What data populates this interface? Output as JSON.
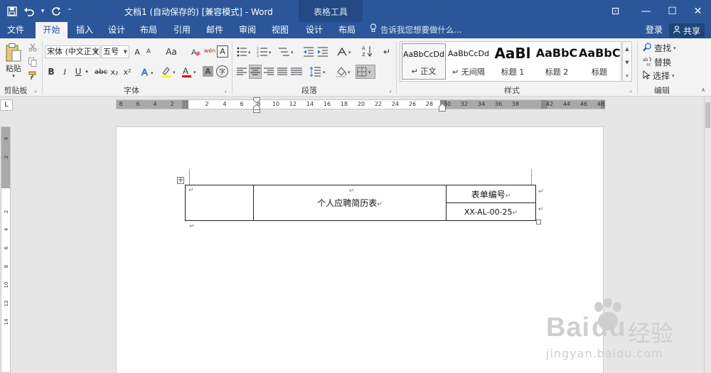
{
  "window": {
    "title": "文档1 (自动保存的) [兼容模式] - Word",
    "context_tab_label": "表格工具",
    "controls": {
      "ribbon_options": "⊡",
      "minimize": "—",
      "maximize": "☐",
      "close": "✕"
    }
  },
  "qat": {
    "save_icon": "save-icon",
    "undo_icon": "undo-icon",
    "redo_icon": "redo-icon"
  },
  "tabs": [
    {
      "label": "文件",
      "active": false
    },
    {
      "label": "开始",
      "active": true
    },
    {
      "label": "插入",
      "active": false
    },
    {
      "label": "设计",
      "active": false
    },
    {
      "label": "布局",
      "active": false
    },
    {
      "label": "引用",
      "active": false
    },
    {
      "label": "邮件",
      "active": false
    },
    {
      "label": "审阅",
      "active": false
    },
    {
      "label": "视图",
      "active": false
    },
    {
      "label": "设计",
      "active": false
    },
    {
      "label": "布局",
      "active": false
    }
  ],
  "tellme": {
    "placeholder": "告诉我您想要做什么..."
  },
  "account": {
    "login": "登录",
    "share": "共享"
  },
  "ribbon": {
    "clipboard": {
      "paste_label": "粘贴",
      "group_label": "剪贴板"
    },
    "font": {
      "font_name": "宋体 (中文正文",
      "font_size": "五号",
      "group_label": "字体",
      "bold": "B",
      "italic": "I",
      "underline": "U",
      "strike": "abc",
      "subscript": "x₂",
      "superscript": "x²",
      "grow": "A",
      "shrink": "A",
      "case": "Aa",
      "phonetic": "wén",
      "clear": "A"
    },
    "paragraph": {
      "group_label": "段落"
    },
    "styles": {
      "group_label": "样式",
      "items": [
        {
          "sample": "AaBbCcDd",
          "name": "↵ 正文",
          "selected": true
        },
        {
          "sample": "AaBbCcDd",
          "name": "↵ 无间隔",
          "selected": false
        },
        {
          "sample": "AaBl",
          "name": "标题 1",
          "selected": false
        },
        {
          "sample": "AaBbC",
          "name": "标题 2",
          "selected": false
        },
        {
          "sample": "AaBbC",
          "name": "标题",
          "selected": false
        }
      ]
    },
    "editing": {
      "group_label": "编辑",
      "find": "查找",
      "replace": "替换",
      "select": "选择"
    }
  },
  "ruler": {
    "tab_selector": "L",
    "labels": [
      "8",
      "6",
      "4",
      "2",
      "2",
      "4",
      "6",
      "8",
      "10",
      "12",
      "14",
      "16",
      "18",
      "20",
      "22",
      "24",
      "26",
      "28",
      "30",
      "32",
      "34",
      "36",
      "38",
      "42",
      "44",
      "46",
      "48"
    ],
    "vertical_labels": [
      "4",
      "2",
      "2",
      "4",
      "6",
      "8",
      "10",
      "12",
      "14"
    ]
  },
  "document": {
    "table": {
      "title": "个人应聘简历表",
      "form_no_label": "表单编号",
      "form_no_value": "XX-AL-00-25"
    },
    "para_mark": "↵"
  },
  "watermark": {
    "brand": "Bai",
    "brand_tail": "du",
    "cn": "经验",
    "url": "jingyan.baidu.com"
  }
}
